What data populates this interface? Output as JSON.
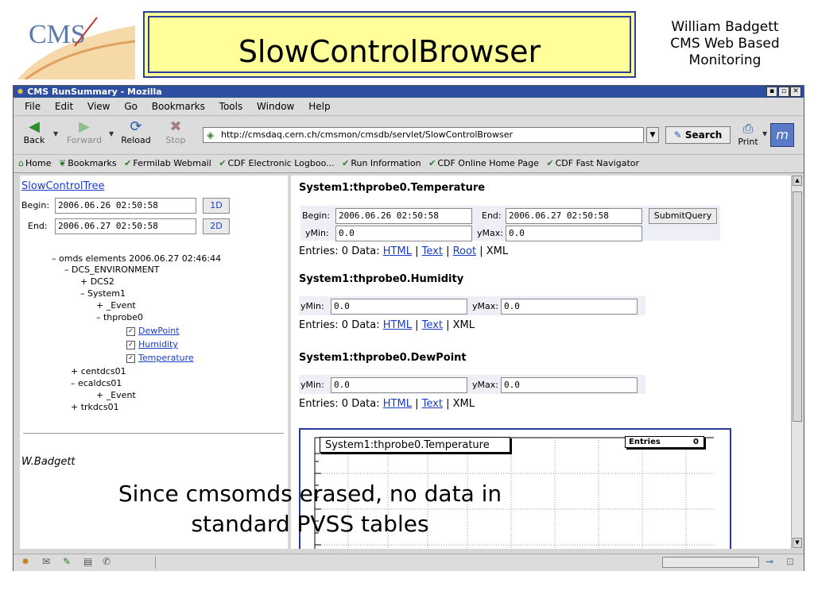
{
  "slide": {
    "title": "SlowControlBrowser",
    "author_lines": [
      "William Badgett",
      "CMS Web Based",
      "Monitoring"
    ],
    "logo_text": "CMS",
    "caption_lines": [
      "Since cmsomds erased, no data in",
      "standard PVSS tables"
    ]
  },
  "window": {
    "title": "CMS RunSummary - Mozilla",
    "controls": [
      "▪",
      "▫",
      "✕"
    ]
  },
  "menu": [
    "File",
    "Edit",
    "View",
    "Go",
    "Bookmarks",
    "Tools",
    "Window",
    "Help"
  ],
  "nav": {
    "back": "Back",
    "forward": "Forward",
    "reload": "Reload",
    "stop": "Stop",
    "url": "http://cmsdaq.cern.ch/cmsmon/cmsdb/servlet/SlowControlBrowser",
    "search": "Search",
    "print": "Print"
  },
  "bookmarks": [
    "Home",
    "Bookmarks",
    "Fermilab Webmail",
    "CDF Electronic Logboo...",
    "Run Information",
    "CDF Online Home Page",
    "CDF Fast Navigator"
  ],
  "left": {
    "tree_link": "SlowControlTree",
    "begin_label": "Begin:",
    "begin_value": "2006.06.26 02:50:58",
    "end_label": "End:",
    "end_value": "2006.06.27 02:50:58",
    "btn_1d": "1D",
    "btn_2d": "2D",
    "tree": [
      "– omds elements 2006.06.27 02:46:44",
      "– DCS_ENVIRONMENT",
      "+ DCS2",
      "– System1",
      "+ _Event",
      "– thprobe0",
      "DewPoint",
      "Humidity",
      "Temperature",
      "+ centdcs01",
      "– ecaldcs01",
      "+ _Event",
      "+ trkdcs01"
    ],
    "signature": "W.Badgett"
  },
  "right": {
    "temp": {
      "heading": "System1:thprobe0.Temperature",
      "begin_label": "Begin:",
      "begin_value": "2006.06.26 02:50:58",
      "end_label": "End:",
      "end_value": "2006.06.27 02:50:58",
      "submit": "SubmitQuery",
      "ymin_label": "yMin:",
      "ymin_value": "0.0",
      "ymax_label": "yMax:",
      "ymax_value": "0.0",
      "entries_prefix": "Entries: 0 Data:",
      "link_html": "HTML",
      "link_text": "Text",
      "link_root": "Root",
      "xml": "XML",
      "sep": "|"
    },
    "humidity": {
      "heading": "System1:thprobe0.Humidity",
      "ymin_label": "yMin:",
      "ymin_value": "0.0",
      "ymax_label": "yMax:",
      "ymax_value": "0.0",
      "entries_prefix": "Entries: 0 Data:",
      "link_html": "HTML",
      "link_text": "Text",
      "xml": "XML",
      "sep": "|"
    },
    "dewpoint": {
      "heading": "System1:thprobe0.DewPoint",
      "ymin_label": "yMin:",
      "ymin_value": "0.0",
      "ymax_label": "yMax:",
      "ymax_value": "0.0",
      "entries_prefix": "Entries: 0 Data:",
      "link_html": "HTML",
      "link_text": "Text",
      "xml": "XML",
      "sep": "|"
    },
    "plot": {
      "title": "System1:thprobe0.Temperature",
      "stats_label": "Entries",
      "stats_value": "0"
    }
  }
}
